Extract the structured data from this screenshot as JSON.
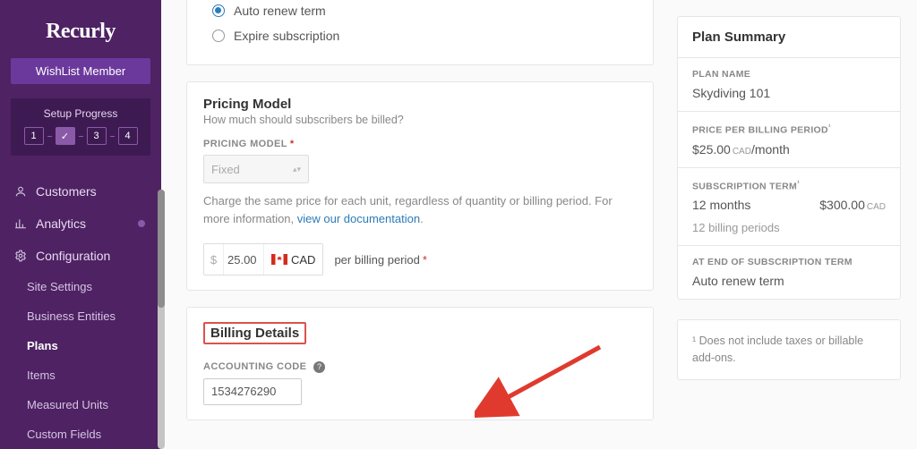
{
  "brand": "Recurly",
  "wishlist_button": "WishList Member",
  "progress": {
    "title": "Setup Progress",
    "steps": [
      "1",
      "✓",
      "3",
      "4"
    ]
  },
  "nav": {
    "customers": "Customers",
    "analytics": "Analytics",
    "configuration": "Configuration",
    "sub": {
      "site_settings": "Site Settings",
      "business_entities": "Business Entities",
      "plans": "Plans",
      "items": "Items",
      "measured_units": "Measured Units",
      "custom_fields": "Custom Fields"
    }
  },
  "term": {
    "auto_renew": "Auto renew term",
    "expire": "Expire subscription"
  },
  "pricing": {
    "heading": "Pricing Model",
    "sub": "How much should subscribers be billed?",
    "model_label": "PRICING MODEL",
    "model_value": "Fixed",
    "desc_prefix": "Charge the same price for each unit, regardless of quantity or billing period. For more information, ",
    "desc_link": "view our documentation",
    "currency_symbol": "$",
    "amount": "25.00",
    "currency_code": "CAD",
    "per_label": "per billing period"
  },
  "billing": {
    "heading": "Billing Details",
    "code_label": "ACCOUNTING CODE",
    "code_value": "1534276290"
  },
  "summary": {
    "title": "Plan Summary",
    "plan_name_label": "PLAN NAME",
    "plan_name": "Skydiving 101",
    "price_label": "PRICE PER BILLING PERIOD",
    "price": "$25.00",
    "price_ccy": "CAD",
    "price_suffix": "/month",
    "term_label": "SUBSCRIPTION TERM",
    "term_value": "12 months",
    "term_total": "$300.00",
    "term_total_ccy": "CAD",
    "term_note": "12 billing periods",
    "end_label": "AT END OF SUBSCRIPTION TERM",
    "end_value": "Auto renew term",
    "footnote_sup": "¹",
    "footnote": " Does not include taxes or billable add-ons."
  }
}
